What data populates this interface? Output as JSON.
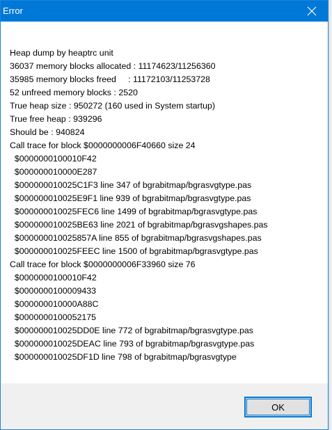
{
  "window": {
    "title": "Error",
    "accent_color": "#0078d7",
    "close_icon": "close-icon"
  },
  "message": {
    "lines": [
      "Heap dump by heaptrc unit",
      "36037 memory blocks allocated : 11174623/11256360",
      "35985 memory blocks freed     : 11172103/11253728",
      "52 unfreed memory blocks : 2520",
      "True heap size : 950272 (160 used in System startup)",
      "True free heap : 939296",
      "Should be : 940824",
      "Call trace for block $0000000006F40660 size 24",
      "  $0000000100010F42",
      "  $000000010000E287",
      "  $000000010025C1F3 line 347 of bgrabitmap/bgrasvgtype.pas",
      "  $000000010025E9F1 line 939 of bgrabitmap/bgrasvgtype.pas",
      "  $000000010025FEC6 line 1499 of bgrabitmap/bgrasvgtype.pas",
      "  $000000010025BE63 line 2021 of bgrabitmap/bgrasvgshapes.pas",
      "  $000000010025857A line 855 of bgrabitmap/bgrasvgshapes.pas",
      "  $000000010025FEEC line 1500 of bgrabitmap/bgrasvgtype.pas",
      "Call trace for block $0000000006F33960 size 76",
      "  $0000000100010F42",
      "  $0000000100009433",
      "  $000000010000A88C",
      "  $0000000100052175",
      "  $000000010025DD0E line 772 of bgrabitmap/bgrasvgtype.pas",
      "  $000000010025DEAC line 793 of bgrabitmap/bgrasvgtype.pas",
      "  $000000010025DF1D line 798 of bgrabitmap/bgrasvgtype"
    ]
  },
  "footer": {
    "ok_label": "OK"
  }
}
